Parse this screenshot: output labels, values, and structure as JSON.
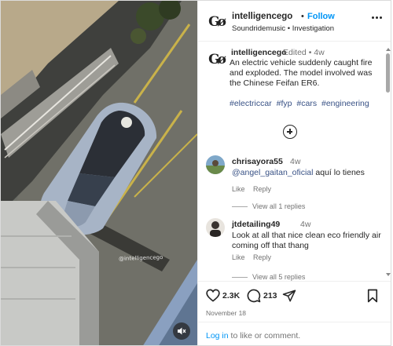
{
  "post": {
    "username": "intelligencego",
    "follow_separator": "•",
    "follow_label": "Follow",
    "subtitle": "Soundridemusic • Investigation",
    "watermark": "@intelligencego"
  },
  "caption": {
    "username": "intelligencego",
    "meta": "Edited • 4w",
    "text": "An electric vehicle suddenly caught fire and exploded. The model involved was the Chinese Feifan ER6.",
    "hashtags": [
      "#electriccar",
      "#fyp",
      "#cars",
      "#engineering"
    ]
  },
  "comments": [
    {
      "username": "chrisayora55",
      "time": "4w",
      "mention": "@angel_gaitan_oficial",
      "text": "aquí lo tienes",
      "like_label": "Like",
      "reply_label": "Reply",
      "view_replies": "View all 1 replies"
    },
    {
      "username": "jtdetailing49",
      "time": "4w",
      "text": "Look at all that nice clean eco friendly air coming off that thang",
      "like_label": "Like",
      "reply_label": "Reply",
      "view_replies": "View all 5 replies"
    }
  ],
  "actions": {
    "likes": "2.3K",
    "comments": "213",
    "date": "November 18"
  },
  "footer": {
    "login_link": "Log in",
    "login_rest": "to like or comment."
  },
  "icons": {
    "logo": "intelligencego-logo",
    "more": "more-options-icon",
    "add": "add-circle-icon",
    "like": "heart-icon",
    "comment": "comment-icon",
    "share": "share-icon",
    "save": "bookmark-icon",
    "mute": "speaker-muted-icon"
  }
}
